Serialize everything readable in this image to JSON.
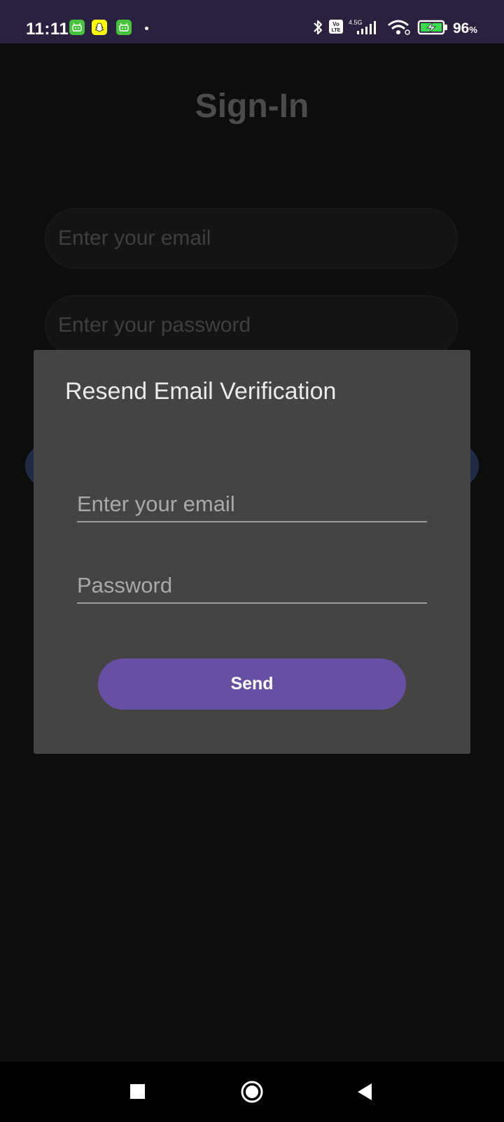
{
  "status_bar": {
    "time": "11:11",
    "battery_percent": "96",
    "battery_unit": "%",
    "network_type": "4.5G",
    "volte_label": "Vo LTE",
    "notification_icons": [
      "android-app-icon",
      "snapchat-icon",
      "android-app-icon"
    ]
  },
  "background_screen": {
    "title": "Sign-In",
    "email_placeholder": "Enter your email",
    "password_placeholder": "Enter your password"
  },
  "dialog": {
    "title": "Resend Email Verification",
    "email_placeholder": "Enter your email",
    "password_placeholder": "Password",
    "send_label": "Send"
  },
  "colors": {
    "status_bar_bg": "#29213f",
    "screen_bg": "#0d0d0d",
    "dialog_bg": "#444444",
    "accent": "#6750a4"
  },
  "nav_bar": {
    "buttons": [
      "recents-icon",
      "home-icon",
      "back-icon"
    ]
  }
}
